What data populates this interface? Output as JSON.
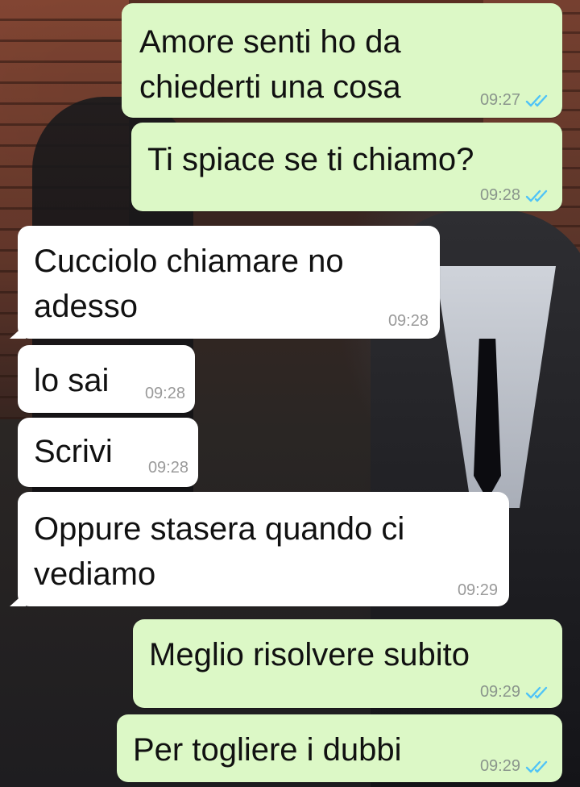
{
  "messages": [
    {
      "direction": "outgoing",
      "text": "Amore senti ho da\nchiederti una cosa",
      "time": "09:27",
      "read": true
    },
    {
      "direction": "outgoing",
      "text": "Ti spiace se ti chiamo?",
      "time": "09:28",
      "read": true
    },
    {
      "direction": "incoming",
      "text": "Cucciolo chiamare no\nadesso",
      "time": "09:28"
    },
    {
      "direction": "incoming",
      "text": "lo sai",
      "time": "09:28"
    },
    {
      "direction": "incoming",
      "text": "Scrivi",
      "time": "09:28"
    },
    {
      "direction": "incoming",
      "text": "Oppure stasera quando ci\nvediamo",
      "time": "09:29"
    },
    {
      "direction": "outgoing",
      "text": "Meglio risolvere subito",
      "time": "09:29",
      "read": true
    },
    {
      "direction": "outgoing",
      "text": "Per togliere i dubbi",
      "time": "09:29",
      "read": true
    }
  ],
  "colors": {
    "outgoing_bubble": "#dcf8c6",
    "incoming_bubble": "#ffffff",
    "read_check": "#4fc3f7"
  },
  "icons": {
    "read_receipt": "double-check-icon"
  }
}
